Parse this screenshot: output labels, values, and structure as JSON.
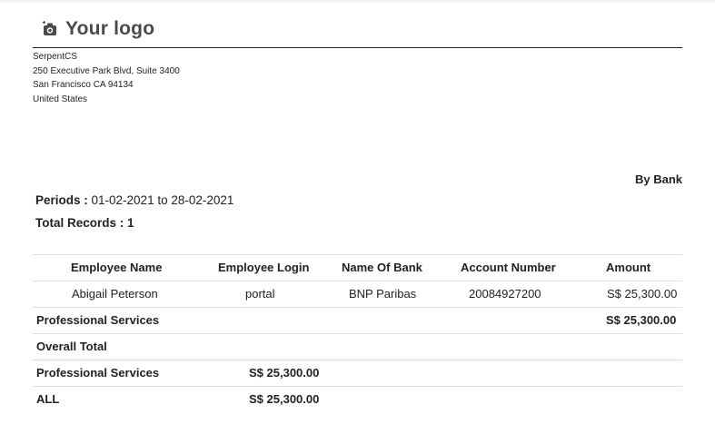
{
  "logo": {
    "icon": "camera-icon",
    "text": "Your logo"
  },
  "company": {
    "name": "SerpentCS",
    "street": "250 Executive Park Blvd, Suite 3400",
    "city": "San Francisco CA 94134",
    "country": "United States"
  },
  "report": {
    "mode": "By Bank",
    "period_label": "Periods : ",
    "period_value": "01-02-2021 to 28-02-2021",
    "records_label": "Total Records : 1"
  },
  "table": {
    "headers": [
      "Employee Name",
      "Employee Login",
      "Name Of Bank",
      "Account Number",
      "Amount"
    ],
    "rows": [
      [
        "Abigail Peterson",
        "portal",
        "BNP Paribas",
        "20084927200",
        "S$ 25,300.00"
      ]
    ],
    "dept_total": {
      "label": "Professional Services",
      "amount": "S$ 25,300.00"
    },
    "overall": {
      "label": "Overall Total",
      "lines": [
        {
          "label": "Professional Services",
          "amount": "S$ 25,300.00"
        },
        {
          "label": "ALL",
          "amount": "S$ 25,300.00"
        }
      ]
    }
  }
}
